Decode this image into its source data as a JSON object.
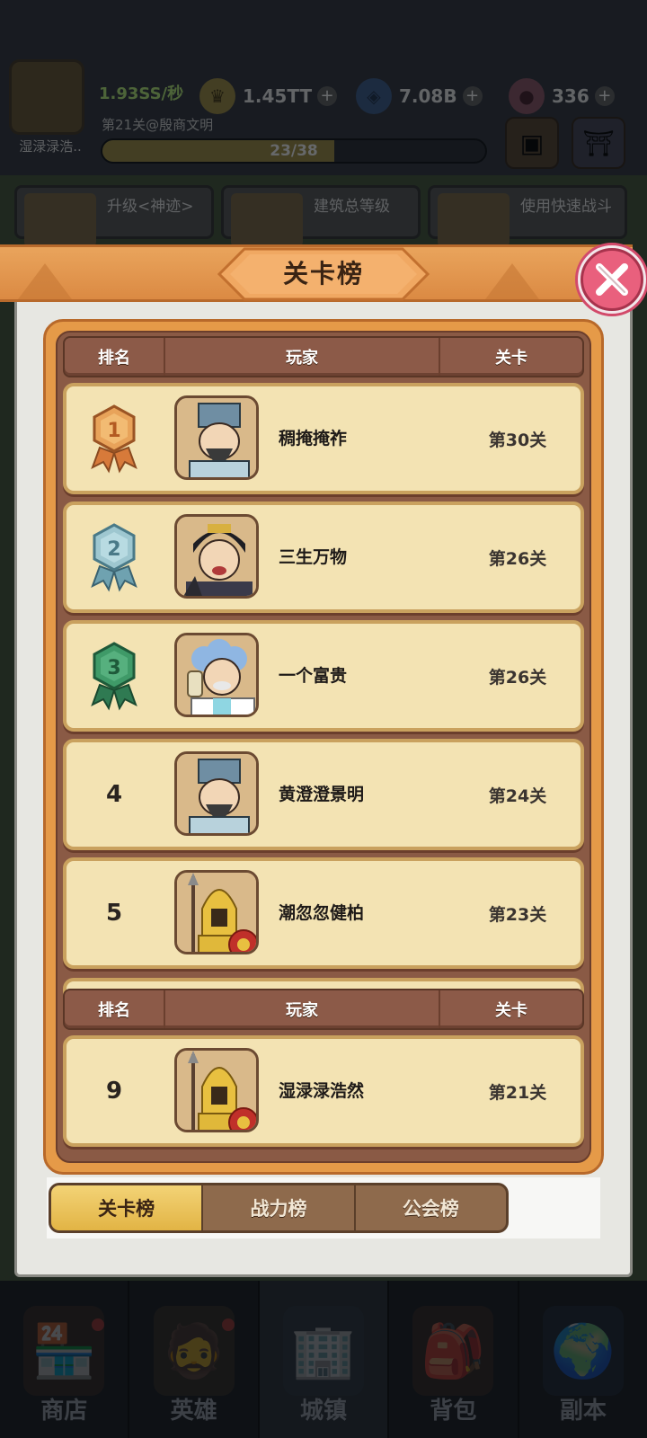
{
  "hud": {
    "player_name": "湿渌渌浩..",
    "income": "1.93SS/秒",
    "stage_info": "第21关@殷商文明",
    "stage_progress_text": "23/38",
    "stage_progress": 0.605,
    "crown_value": "1.45TT",
    "gem_value": "7.08B",
    "candy_value": "336"
  },
  "quests": [
    {
      "label": "升级<神迹>"
    },
    {
      "label": "建筑总等级"
    },
    {
      "label": "使用快速战斗"
    }
  ],
  "modal": {
    "title": "关卡榜",
    "headers": {
      "rank": "排名",
      "player": "玩家",
      "stage": "关卡"
    },
    "rows": [
      {
        "rank": "1",
        "medal": "gold-medal",
        "name": "稠掩掩祚",
        "stage": "第30关",
        "avatar": "scholar-avatar"
      },
      {
        "rank": "2",
        "medal": "silver-medal",
        "name": "三生万物",
        "stage": "第26关",
        "avatar": "warrior-avatar"
      },
      {
        "rank": "3",
        "medal": "green-medal",
        "name": "一个富贵",
        "stage": "第26关",
        "avatar": "scientist-avatar"
      },
      {
        "rank": "4",
        "medal": "",
        "name": "黄澄澄景明",
        "stage": "第24关",
        "avatar": "scholar-avatar"
      },
      {
        "rank": "5",
        "medal": "",
        "name": "潮忽忽健柏",
        "stage": "第23关",
        "avatar": "spartan-avatar"
      }
    ],
    "my_row": {
      "rank": "9",
      "name": "湿渌渌浩然",
      "stage": "第21关",
      "avatar": "spartan-avatar"
    },
    "tabs": [
      {
        "label": "关卡榜",
        "active": true
      },
      {
        "label": "战力榜",
        "active": false
      },
      {
        "label": "公会榜",
        "active": false
      }
    ]
  },
  "nav": [
    {
      "label": "商店",
      "icon": "shop-icon"
    },
    {
      "label": "英雄",
      "icon": "hero-icon"
    },
    {
      "label": "城镇",
      "icon": "town-icon"
    },
    {
      "label": "背包",
      "icon": "backpack-icon"
    },
    {
      "label": "副本",
      "icon": "globe-icon"
    }
  ],
  "colors": {
    "accent": "#e59a48",
    "row_bg": "#f3e3b3",
    "tab_active": "#f3d376",
    "close": "#e9607d"
  }
}
